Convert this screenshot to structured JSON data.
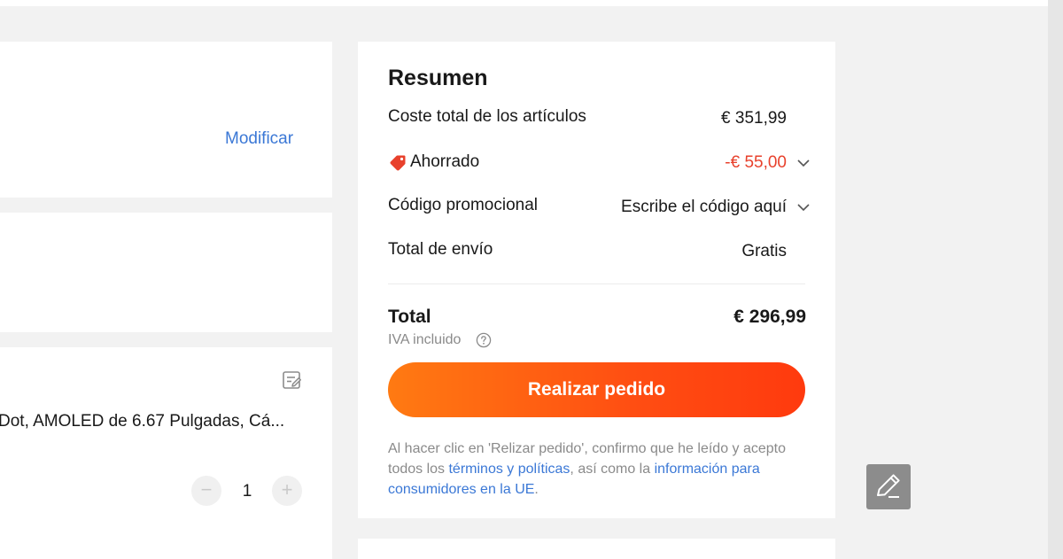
{
  "address": {
    "modify_label": "Modificar"
  },
  "item": {
    "title": "Dot, AMOLED de 6.67 Pulgadas, Cá...",
    "quantity": "1",
    "minus_symbol": "−",
    "plus_symbol": "+"
  },
  "summary": {
    "title": "Resumen",
    "rows": [
      {
        "label": "Coste total de los artículos",
        "value": "€ 351,99"
      },
      {
        "label": "Ahorrado",
        "value": "-€ 55,00"
      },
      {
        "label": "Código promocional",
        "value": "Escribe el código aquí"
      },
      {
        "label": "Total de envío",
        "value": "Gratis"
      }
    ],
    "total_label": "Total",
    "total_value": "€ 296,99",
    "tax_note": "IVA incluido",
    "cta_label": "Realizar pedido",
    "legal": {
      "part1": "Al hacer clic en 'Relizar pedido', confirmo que he leído y acepto todos los ",
      "terms_link": "términos y políticas",
      "part2": ", así como la ",
      "info_link": "información para consumidores en la UE",
      "part3": "."
    }
  },
  "icons": {
    "savings": "tag-icon",
    "help": "question-circle-icon",
    "note": "note-edit-icon",
    "chevron": "chevron-down-icon",
    "floating": "pencil-icon"
  },
  "colors": {
    "accent": "#ff4d12",
    "discount": "#e8412c",
    "link": "#3b78d6",
    "muted": "#8a8a8a"
  }
}
